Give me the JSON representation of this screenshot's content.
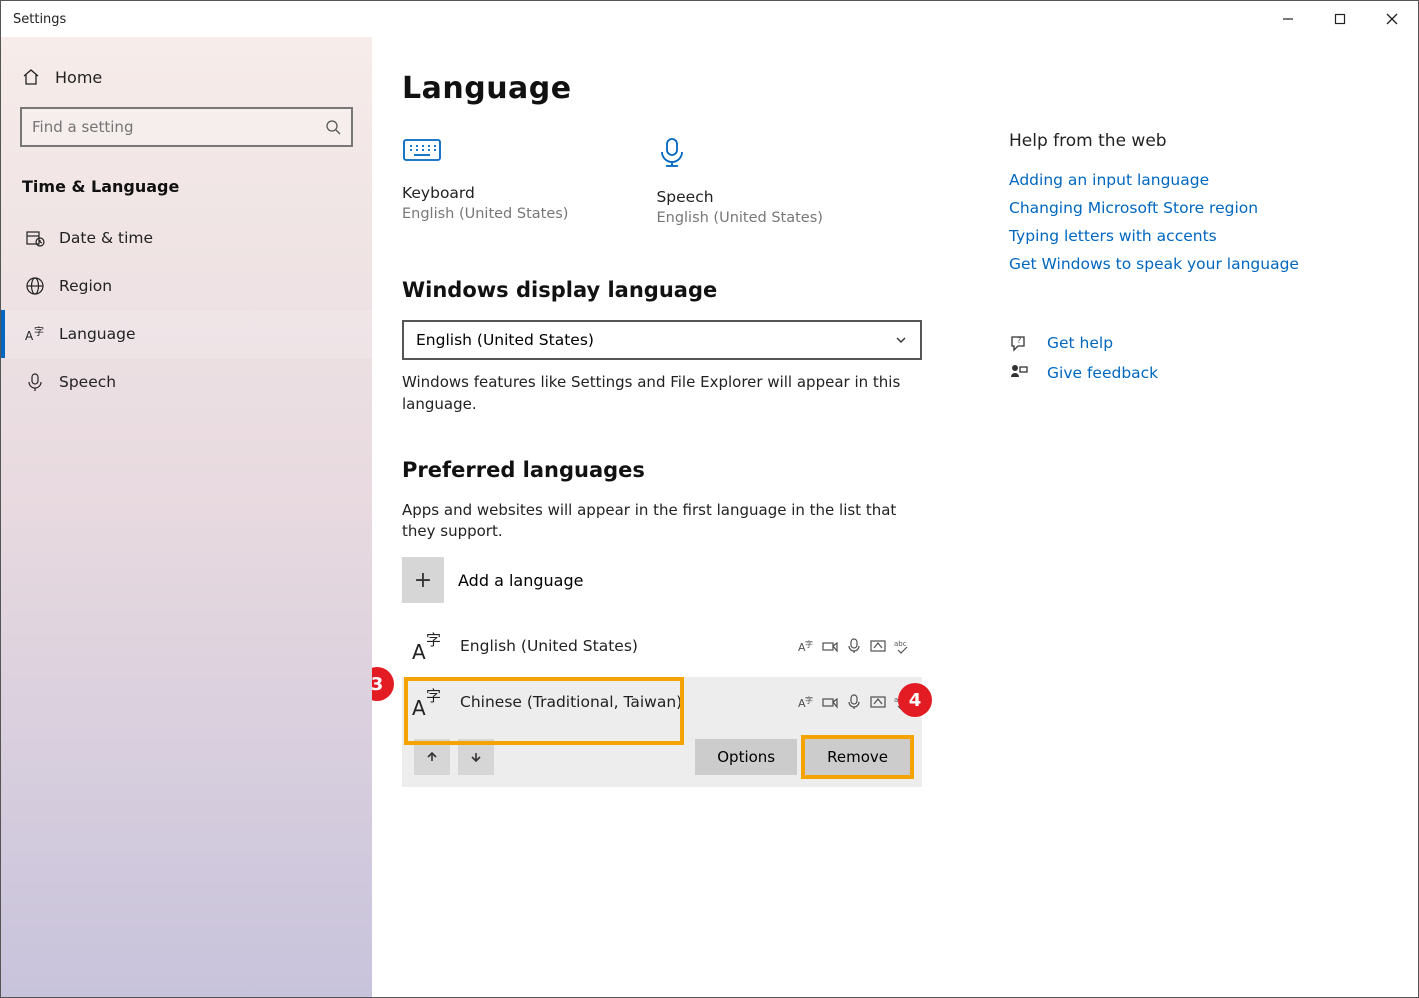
{
  "window": {
    "title": "Settings"
  },
  "sidebar": {
    "home": "Home",
    "search_placeholder": "Find a setting",
    "section": "Time & Language",
    "items": [
      {
        "label": "Date & time"
      },
      {
        "label": "Region"
      },
      {
        "label": "Language"
      },
      {
        "label": "Speech"
      }
    ]
  },
  "page": {
    "title": "Language",
    "quick": {
      "keyboard": {
        "title": "Keyboard",
        "sub": "English (United States)"
      },
      "speech": {
        "title": "Speech",
        "sub": "English (United States)"
      }
    },
    "displaylang": {
      "heading": "Windows display language",
      "selected": "English (United States)",
      "desc": "Windows features like Settings and File Explorer will appear in this language."
    },
    "preferred": {
      "heading": "Preferred languages",
      "desc": "Apps and websites will appear in the first language in the list that they support.",
      "add_label": "Add a language",
      "items": [
        {
          "name": "English (United States)"
        },
        {
          "name": "Chinese (Traditional, Taiwan)"
        }
      ],
      "options_btn": "Options",
      "remove_btn": "Remove"
    }
  },
  "help": {
    "heading": "Help from the web",
    "links": [
      "Adding an input language",
      "Changing Microsoft Store region",
      "Typing letters with accents",
      "Get Windows to speak your language"
    ],
    "get_help": "Get help",
    "feedback": "Give feedback"
  },
  "annotations": {
    "step3": "3",
    "step4": "4"
  }
}
